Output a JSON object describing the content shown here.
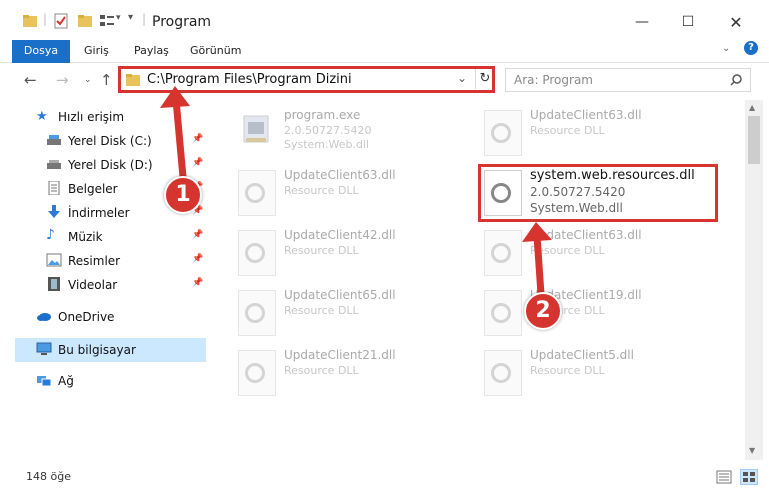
{
  "window": {
    "title": "Program"
  },
  "ribbon": {
    "tabs": [
      "Dosya",
      "Giriş",
      "Paylaş",
      "Görünüm"
    ]
  },
  "address": {
    "path": "C:\\Program Files\\Program Dizini"
  },
  "search": {
    "placeholder": "Ara: Program"
  },
  "sidebar": {
    "items": [
      {
        "label": "Hızlı erişim",
        "icon": "star-icon"
      },
      {
        "label": "Yerel Disk (C:)",
        "icon": "drive-icon",
        "pinned": true
      },
      {
        "label": "Yerel Disk (D:)",
        "icon": "drive-icon",
        "pinned": true
      },
      {
        "label": "Belgeler",
        "icon": "documents-icon",
        "pinned": true
      },
      {
        "label": "İndirmeler",
        "icon": "download-icon",
        "pinned": true
      },
      {
        "label": "Müzik",
        "icon": "music-icon",
        "pinned": true
      },
      {
        "label": "Resimler",
        "icon": "pictures-icon",
        "pinned": true
      },
      {
        "label": "Videolar",
        "icon": "videos-icon",
        "pinned": true
      },
      {
        "label": "OneDrive",
        "icon": "cloud-icon"
      },
      {
        "label": "Bu bilgisayar",
        "icon": "computer-icon",
        "selected": true
      },
      {
        "label": "Ağ",
        "icon": "network-icon"
      }
    ]
  },
  "files": [
    {
      "name": "program.exe",
      "line2": "2.0.50727.5420",
      "line3": "System.Web.dll"
    },
    {
      "name": "UpdateClient63.dll",
      "line2": "Resource DLL",
      "line3": ""
    },
    {
      "name": "UpdateClient63.dll",
      "line2": "Resource DLL",
      "line3": ""
    },
    {
      "name": "system.web.resources.dll",
      "line2": "2.0.50727.5420",
      "line3": "System.Web.dll"
    },
    {
      "name": "UpdateClient42.dll",
      "line2": "Resource DLL",
      "line3": ""
    },
    {
      "name": "UpdateClient63.dll",
      "line2": "Resource DLL",
      "line3": ""
    },
    {
      "name": "UpdateClient65.dll",
      "line2": "Resource DLL",
      "line3": ""
    },
    {
      "name": "UpdateClient19.dll",
      "line2": "Resource DLL",
      "line3": ""
    },
    {
      "name": "UpdateClient21.dll",
      "line2": "Resource DLL",
      "line3": ""
    },
    {
      "name": "UpdateClient5.dll",
      "line2": "Resource DLL",
      "line3": ""
    }
  ],
  "annotations": {
    "badge1": "1",
    "badge2": "2",
    "color": "#d6352f"
  },
  "status": {
    "item_count": "148 öğe"
  }
}
